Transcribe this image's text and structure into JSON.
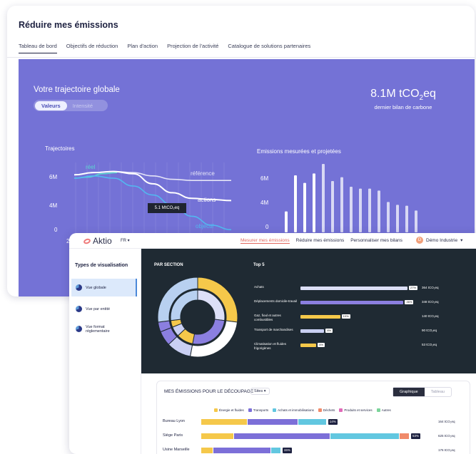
{
  "window1": {
    "title": "Réduire mes émissions",
    "tabs": [
      {
        "label": "Tableau de bord",
        "active": true
      },
      {
        "label": "Objectifs de réduction"
      },
      {
        "label": "Plan d'action"
      },
      {
        "label": "Projection de l'activité"
      },
      {
        "label": "Catalogue de solutions partenaires"
      }
    ],
    "heading": "Votre trajectoire globale",
    "toggle": {
      "on": "Valeurs",
      "off": "Intensité"
    },
    "total_prefix": "8.1M tCO",
    "total_sub": "2",
    "total_suffix": "eq",
    "total_caption": "dernier bilan de carbone",
    "traj_label": "Trajectoires",
    "emis_label": "Emissions mesurées et projetées",
    "line_labels": {
      "reel": "réel",
      "reference": "référence",
      "actions": "actions",
      "objectif": "objectif"
    },
    "tooltip": "5.1 MtCO₂eq",
    "x_first_tick": "2",
    "colors": {
      "panel": "#7472d6",
      "reel": "#5bd6d0",
      "objectif": "#52b8f0"
    }
  },
  "window2": {
    "brand": "Aktio",
    "lang": "FR",
    "nav": [
      {
        "label": "Mesurer mes émissions",
        "active": true
      },
      {
        "label": "Réduire mes émissions"
      },
      {
        "label": "Personnaliser mes bilans"
      }
    ],
    "org_initial": "D",
    "org": "Démo Industrie",
    "side_title": "Types de visualisation",
    "side_items": [
      {
        "label": "Vue globale",
        "active": true
      },
      {
        "label": "Vue par entité"
      },
      {
        "label": "Vue format réglementaire"
      }
    ],
    "par_section": "PAR SECTION",
    "top5_title": "Top 5",
    "top5": [
      {
        "name": "Achats",
        "pct": "27%",
        "value": "364 tCO₂eq",
        "fraction": 0.27,
        "color": "#dcdff7"
      },
      {
        "name": "Déplacements domicile-travail",
        "pct": "26%",
        "value": "348 tCO₂eq",
        "fraction": 0.26,
        "color": "#8b7fe0"
      },
      {
        "name": "Gaz, fioul et autres combustibles",
        "pct": "10%",
        "value": "140 tCO₂eq",
        "fraction": 0.1,
        "color": "#f5c84a"
      },
      {
        "name": "Transport de marchandises",
        "pct": "6%",
        "value": "90 tCO₂eq",
        "fraction": 0.06,
        "color": "#c9cff2"
      },
      {
        "name": "Climatisation et fluides frigorigènes",
        "pct": "4%",
        "value": "53 tCO₂eq",
        "fraction": 0.04,
        "color": "#f5c84a"
      }
    ],
    "card_title": "MES ÉMISSIONS POUR LE DÉCOUPAGE",
    "sites_select": "Sites",
    "view_toggle": {
      "on": "Graphique",
      "off": "Tableau"
    },
    "legend": [
      {
        "label": "Énergie et fluides",
        "color": "#f5c84a"
      },
      {
        "label": "Transports",
        "color": "#7c6fd8"
      },
      {
        "label": "Achats et immobilisations",
        "color": "#62c7e0"
      },
      {
        "label": "Déchets",
        "color": "#f08a6a"
      },
      {
        "label": "Produits et services",
        "color": "#e06ab8"
      },
      {
        "label": "Autres",
        "color": "#7bd49a"
      }
    ],
    "sites": [
      {
        "name": "Bureau Lyon",
        "pct": "14%",
        "value": "164 tCO₂eq",
        "parts": [
          0.2,
          0.22,
          0.12
        ]
      },
      {
        "name": "Siège Paris",
        "pct": "53%",
        "value": "625 tCO₂eq",
        "parts": [
          0.14,
          0.42,
          0.3,
          0.04
        ]
      },
      {
        "name": "Usine Marseille",
        "pct": "15%",
        "value": "176 tCO₂eq",
        "parts": [
          0.05,
          0.25,
          0.04
        ]
      }
    ]
  },
  "chart_data": [
    {
      "type": "line",
      "title": "Trajectoires",
      "yticks": [
        "6M",
        "4M",
        "0"
      ],
      "series": [
        {
          "name": "réel",
          "values": [
            5.6,
            5.7,
            6.0,
            6.1
          ]
        },
        {
          "name": "référence",
          "values": [
            5.9,
            6.1,
            6.2,
            6.1,
            5.8,
            5.5,
            5.4,
            5.4,
            5.4
          ]
        },
        {
          "name": "actions",
          "values": [
            5.9,
            6.1,
            6.2,
            6.0,
            5.1,
            4.3,
            3.8,
            3.7,
            3.6
          ]
        },
        {
          "name": "objectif",
          "values": [
            5.6,
            5.8,
            5.6,
            4.9,
            4.1,
            3.2,
            2.2,
            1.4,
            1.0
          ]
        }
      ]
    },
    {
      "type": "bar",
      "title": "Emissions mesurées et projetées",
      "yticks": [
        "6M",
        "4M",
        "0"
      ],
      "series": [
        {
          "name": "mesurées",
          "values": [
            2.2,
            6.0,
            5.2,
            6.2,
            7.2,
            5.4,
            5.8,
            4.8,
            4.6,
            4.6,
            4.4,
            3.2,
            2.9,
            2.8,
            2.3
          ]
        },
        {
          "name": "projetées",
          "values": [
            0,
            0,
            0,
            0,
            0,
            0,
            0,
            0,
            0,
            0,
            0,
            0,
            0,
            0,
            0
          ]
        }
      ]
    },
    {
      "type": "pie",
      "title": "PAR SECTION",
      "labels": [
        "Achats",
        "Déplacements domicile-travail",
        "Gaz, fioul et autres combustibles",
        "Transport de marchandises",
        "Climatisation et fluides frigorigènes",
        "Autres"
      ],
      "values": [
        27,
        26,
        10,
        6,
        4,
        27
      ]
    }
  ]
}
